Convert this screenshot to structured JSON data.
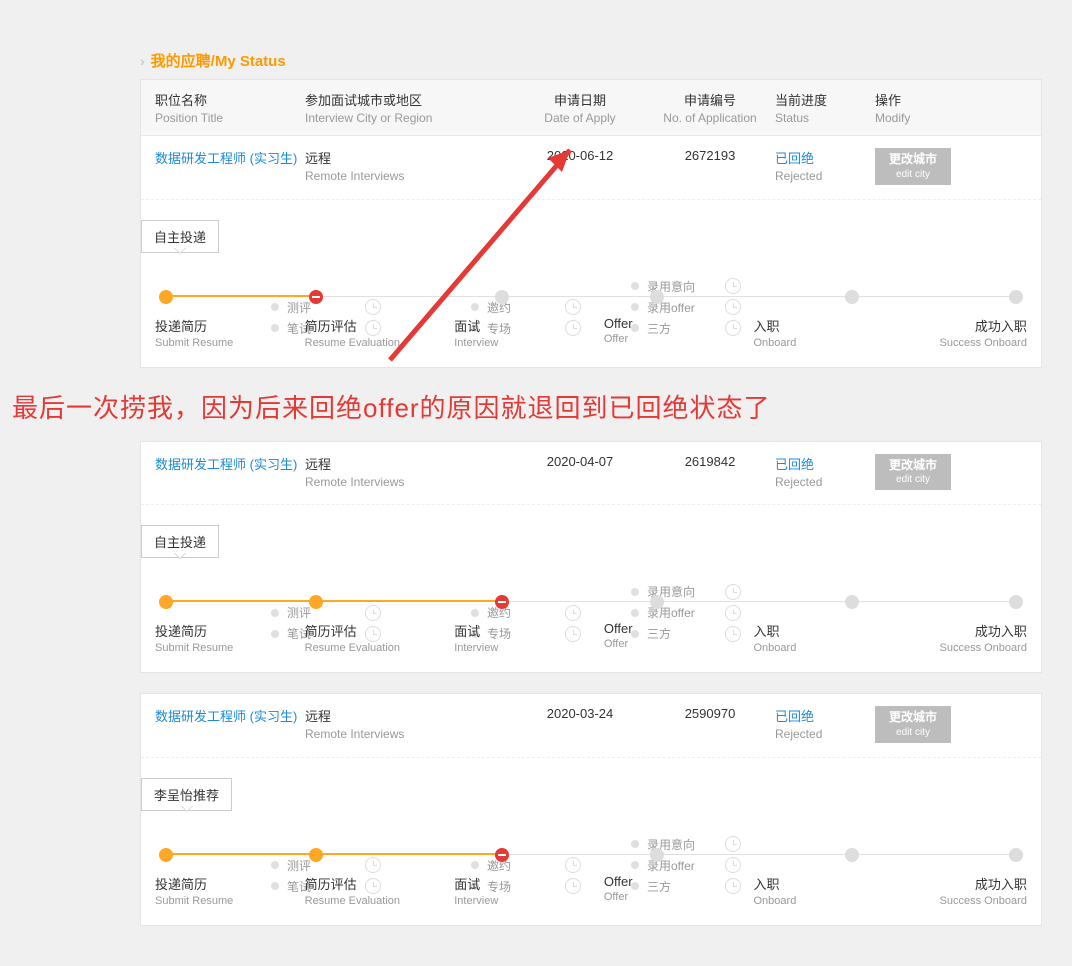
{
  "section_title": "我的应聘/My Status",
  "head": {
    "title_cn": "职位名称",
    "title_en": "Position Title",
    "city_cn": "参加面试城市或地区",
    "city_en": "Interview City or Region",
    "date_cn": "申请日期",
    "date_en": "Date of Apply",
    "no_cn": "申请编号",
    "no_en": "No. of Application",
    "status_cn": "当前进度",
    "status_en": "Status",
    "op_cn": "操作",
    "op_en": "Modify"
  },
  "btn": {
    "cn": "更改城市",
    "en": "edit city"
  },
  "steps": {
    "s1_cn": "投递简历",
    "s1_en": "Submit Resume",
    "s2_cn": "简历评估",
    "s2_en": "Resume Evaluation",
    "s3_cn": "面试",
    "s3_en": "Interview",
    "s4_cn": "Offer",
    "s4_en": "Offer",
    "s5_cn": "入职",
    "s5_en": "Onboard",
    "s6_cn": "成功入职",
    "s6_en": "Success Onboard"
  },
  "sub2": [
    "测评",
    "笔试"
  ],
  "sub3": [
    "邀约",
    "专场"
  ],
  "sub4": [
    "录用意向",
    "录用offer",
    "三方"
  ],
  "apps": [
    {
      "pos_cn": "数据研发工程师 (实习生)",
      "city_cn": "远程",
      "city_en": "Remote Interviews",
      "date": "2020-06-12",
      "no": "2672193",
      "status_cn": "已回绝",
      "status_en": "Rejected",
      "badge": "自主投递",
      "fail_at": 2
    },
    {
      "pos_cn": "数据研发工程师 (实习生)",
      "city_cn": "远程",
      "city_en": "Remote Interviews",
      "date": "2020-04-07",
      "no": "2619842",
      "status_cn": "已回绝",
      "status_en": "Rejected",
      "badge": "自主投递",
      "fail_at": 3
    },
    {
      "pos_cn": "数据研发工程师 (实习生)",
      "city_cn": "远程",
      "city_en": "Remote Interviews",
      "date": "2020-03-24",
      "no": "2590970",
      "status_cn": "已回绝",
      "status_en": "Rejected",
      "badge": "李呈怡推荐",
      "fail_at": 3
    }
  ],
  "annotation": "最后一次捞我，因为后来回绝offer的原因就退回到已回绝状态了"
}
